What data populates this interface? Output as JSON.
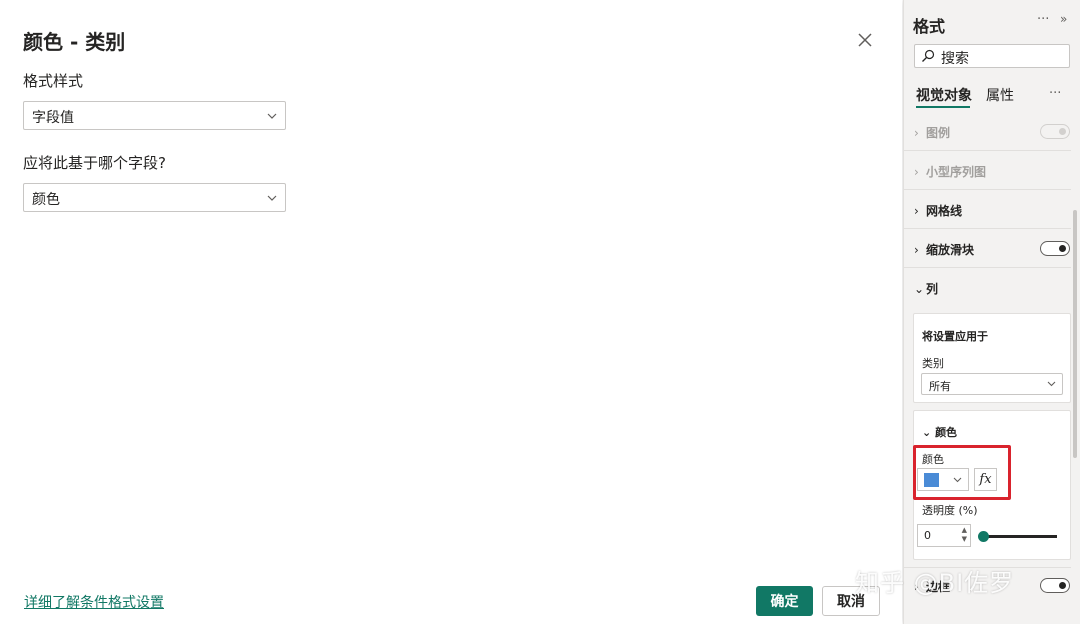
{
  "dialog": {
    "title": "颜色 - 类别",
    "format_style_label": "格式样式",
    "format_style_value": "字段值",
    "field_question": "应将此基于哪个字段?",
    "field_value": "颜色",
    "learn_more": "详细了解条件格式设置",
    "ok_label": "确定",
    "cancel_label": "取消"
  },
  "pane": {
    "title": "格式",
    "more": "···",
    "collapse": "»",
    "search_placeholder": "搜索",
    "tabs": [
      {
        "label": "视觉对象",
        "active": true
      },
      {
        "label": "属性",
        "active": false
      }
    ],
    "tab_more": "···",
    "sections": {
      "legend": "图例",
      "small_multiples": "小型序列图",
      "gridlines": "网格线",
      "zoom_slider": "缩放滑块",
      "columns": "列",
      "next": "边框"
    },
    "columns_panel": {
      "apply_to": "将设置应用于",
      "category_label": "类别",
      "category_value": "所有"
    },
    "color_panel": {
      "header": "颜色",
      "color_label": "颜色",
      "swatch_color": "#4a8bd6",
      "fx_label": "fx",
      "transparency_label": "透明度 (%)",
      "transparency_value": "0"
    }
  },
  "watermark": "知乎 @BI佐罗",
  "colors": {
    "accent": "#117865",
    "highlight": "#d9232d"
  }
}
